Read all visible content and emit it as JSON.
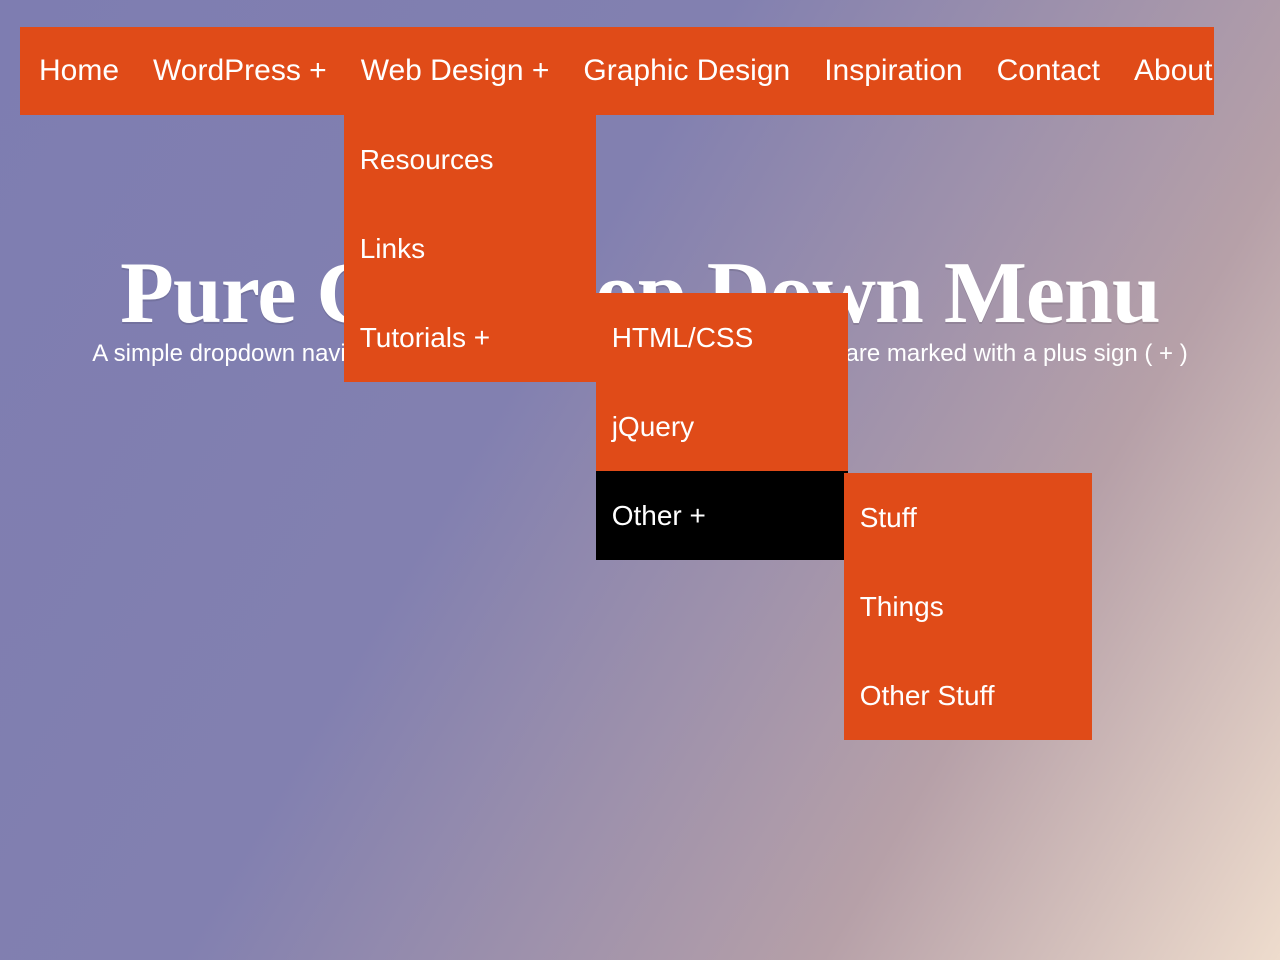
{
  "hero": {
    "title": "Pure CSS Drop Down Menu",
    "subtitle": "A simple dropdown navigation menu made with CSS Only. Dropdowns are marked with a plus sign ( + )"
  },
  "nav": {
    "home": "Home",
    "wordpress": "WordPress +",
    "webdesign": "Web Design +",
    "graphicdesign": "Graphic Design",
    "inspiration": "Inspiration",
    "contact": "Contact",
    "about": "About",
    "webdesign_children": {
      "resources": "Resources",
      "links": "Links",
      "tutorials": "Tutorials +",
      "tutorials_children": {
        "htmlcss": "HTML/CSS",
        "jquery": "jQuery",
        "other": "Other +",
        "other_children": {
          "stuff": "Stuff",
          "things": "Things",
          "otherstuff": "Other Stuff"
        }
      }
    }
  },
  "colors": {
    "accent": "#E04B18",
    "hover": "#000000"
  }
}
